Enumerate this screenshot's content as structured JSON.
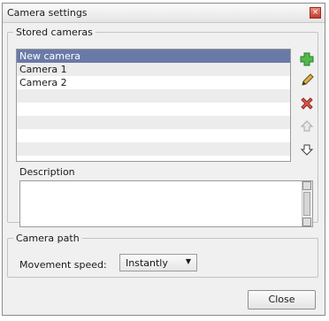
{
  "window": {
    "title": "Camera settings",
    "close_glyph": "×"
  },
  "stored_cameras": {
    "legend": "Stored cameras",
    "items": [
      {
        "label": "New camera",
        "selected": true
      },
      {
        "label": "Camera 1",
        "selected": false
      },
      {
        "label": "Camera 2",
        "selected": false
      }
    ],
    "empty_rows": 5,
    "buttons": [
      {
        "name": "add-camera-button",
        "icon": "plus-icon",
        "color": "#3ea33a",
        "enabled": true
      },
      {
        "name": "edit-camera-button",
        "icon": "pencil-icon",
        "color": "#9a7a2a",
        "enabled": true
      },
      {
        "name": "delete-camera-button",
        "icon": "delete-x-icon",
        "color": "#d0443a",
        "enabled": true
      },
      {
        "name": "move-up-button",
        "icon": "arrow-up-icon",
        "color": "#9a9a9a",
        "enabled": false
      },
      {
        "name": "move-down-button",
        "icon": "arrow-down-icon",
        "color": "#555555",
        "enabled": true
      }
    ]
  },
  "description": {
    "label": "Description",
    "value": ""
  },
  "camera_path": {
    "legend": "Camera path",
    "movement_speed_label": "Movement speed:",
    "movement_speed_value": "Instantly",
    "dropdown_glyph": "▼"
  },
  "footer": {
    "close_label": "Close"
  },
  "colors": {
    "selection": "#6a7aa8",
    "alt_row": "#ececec"
  }
}
